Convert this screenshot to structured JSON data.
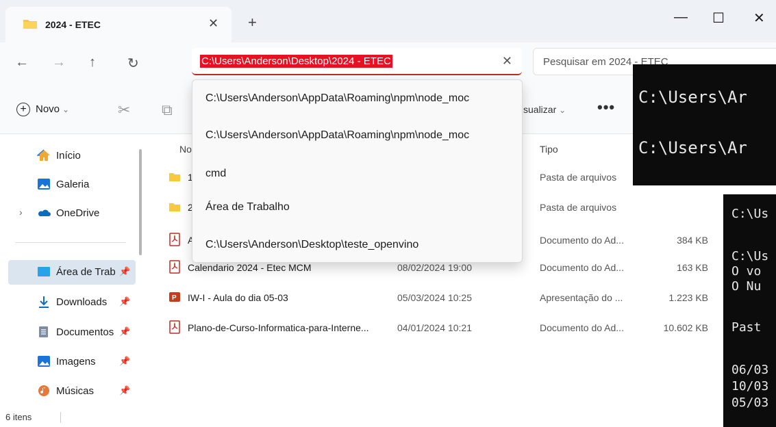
{
  "window": {
    "tab_title": "2024 - ETEC",
    "tab_close": "✕",
    "new_tab": "+",
    "minimize": "—",
    "maximize": "☐",
    "close": "✕"
  },
  "nav": {
    "back": "←",
    "forward": "→",
    "up": "↑",
    "refresh": "↻",
    "address": "C:\\Users\\Anderson\\Desktop\\2024 - ETEC",
    "address_clear": "✕",
    "search_placeholder": "Pesquisar em 2024 - ETEC"
  },
  "commands": {
    "new_label": "Novo",
    "view_label": "sualizar",
    "more": "•••"
  },
  "sidebar": {
    "items": [
      {
        "label": "Início",
        "icon": "home-icon"
      },
      {
        "label": "Galeria",
        "icon": "gallery-icon"
      },
      {
        "label": "OneDrive",
        "icon": "onedrive-icon"
      },
      {
        "label": "Área de Trab",
        "icon": "desktop-icon"
      },
      {
        "label": "Downloads",
        "icon": "download-icon"
      },
      {
        "label": "Documentos",
        "icon": "documents-icon"
      },
      {
        "label": "Imagens",
        "icon": "pictures-icon"
      },
      {
        "label": "Músicas",
        "icon": "music-icon"
      }
    ]
  },
  "list": {
    "header_name": "No",
    "header_type": "Tipo",
    "rows": [
      {
        "name": "1",
        "date": "",
        "type": "Pasta de arquivos",
        "size": "",
        "icon": "folder-icon"
      },
      {
        "name": "2",
        "date": "",
        "type": "Pasta de arquivos",
        "size": "",
        "icon": "folder-icon"
      },
      {
        "name": "A",
        "date": "",
        "type": "Documento do Ad...",
        "size": "384 KB",
        "icon": "pdf-icon"
      },
      {
        "name": "Calendario 2024 - Etec MCM",
        "date": "08/02/2024 19:00",
        "type": "Documento do Ad...",
        "size": "163 KB",
        "icon": "pdf-icon"
      },
      {
        "name": "IW-I - Aula do dia 05-03",
        "date": "05/03/2024 10:25",
        "type": "Apresentação do ...",
        "size": "1.223 KB",
        "icon": "pptx-icon"
      },
      {
        "name": "Plano-de-Curso-Informatica-para-Interne...",
        "date": "04/01/2024 10:21",
        "type": "Documento do Ad...",
        "size": "10.602 KB",
        "icon": "pdf-icon"
      }
    ]
  },
  "status": {
    "count": "6 itens"
  },
  "autocomplete": {
    "items": [
      "C:\\Users\\Anderson\\AppData\\Roaming\\npm\\node_moc",
      "C:\\Users\\Anderson\\AppData\\Roaming\\npm\\node_moc",
      "cmd",
      "Área de Trabalho",
      "C:\\Users\\Anderson\\Desktop\\teste_openvino"
    ]
  },
  "terminal1": {
    "lines": [
      "C:\\Users\\Ar",
      "C:\\Users\\Ar"
    ]
  },
  "terminal2": {
    "lines": [
      "C:\\Us",
      "C:\\Us",
      " O vo",
      " O Nu",
      " Past",
      "06/03",
      "10/03",
      "05/03"
    ]
  },
  "colors": {
    "accent_red": "#c42b1c",
    "selection_red": "#e81123",
    "folder_yellow": "#f8c940",
    "sidebar_selected": "#dbe5f0"
  }
}
